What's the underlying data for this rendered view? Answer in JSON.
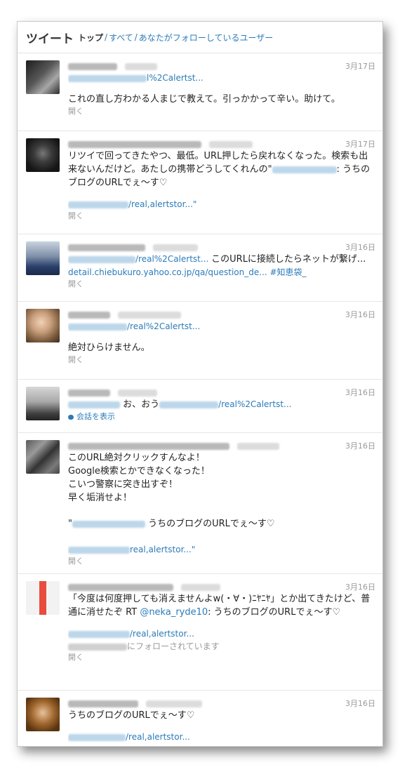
{
  "header": {
    "title": "ツイート",
    "tabs": [
      {
        "label": "トップ",
        "active": true
      },
      {
        "label": "すべて",
        "active": false
      },
      {
        "label": "あなたがフォローしているユーザー",
        "active": false
      }
    ],
    "separator": "/"
  },
  "tweets": [
    {
      "date": "3月17日",
      "url_fragment": "l%2Calertst...",
      "text": "これの直し方わかる人まじで教えて。引っかかって辛い。助けて。",
      "open": "開く"
    },
    {
      "date": "3月17日",
      "text_main": "リツイで回ってきたやつ、最低。URL押したら戻れなくなった。検索も出来ないんだけど。あたしの携帯どうしてくれんの\"",
      "text_tail": ": うちのブログのURLでぇ～す♡",
      "url_fragment": "/real,alertstor...\"",
      "open": "開く"
    },
    {
      "date": "3月16日",
      "url_fragment": "/real%2Calertst...",
      "text": "このURLに接続したらネットが繋げ...",
      "link2": "detail.chiebukuro.yahoo.co.jp/qa/question_de...",
      "hashtag": "#知恵袋_",
      "open": "開く"
    },
    {
      "date": "3月16日",
      "url_fragment": "/real%2Calertst...",
      "text": "絶対ひらけません。",
      "open": "開く"
    },
    {
      "date": "3月16日",
      "text": "お、おう",
      "url_fragment": "/real%2Calertst...",
      "conversation": "会話を表示"
    },
    {
      "date": "3月16日",
      "text": "このURL絶対クリックすんなよ！\nGoogle検索とかできなくなった！\nこいつ警察に突き出すぞ！\n早く垢消せよ！",
      "quote_prefix": "\"",
      "quote_text": "うちのブログのURLでぇ～す♡",
      "url_fragment": "real,alertstor...\"",
      "open": "開く"
    },
    {
      "date": "3月16日",
      "text": "「今度は何度押しても消えませんよw(・∀・)ﾆﾔﾆﾔ」とか出てきたけど、普通に消せたぞ RT",
      "mention": "@neka_ryde10",
      "text_tail": ": うちのブログのURLでぇ～す♡",
      "url_fragment": "/real,alertstor...",
      "followed": "にフォローされています",
      "open": "開く"
    },
    {
      "date": "3月16日",
      "text": "うちのブログのURLでぇ～す♡",
      "url_fragment": "/real,alertstor..."
    }
  ],
  "colors": {
    "link": "#2b7bb9",
    "muted": "#999999",
    "border": "#e6e6e6"
  }
}
